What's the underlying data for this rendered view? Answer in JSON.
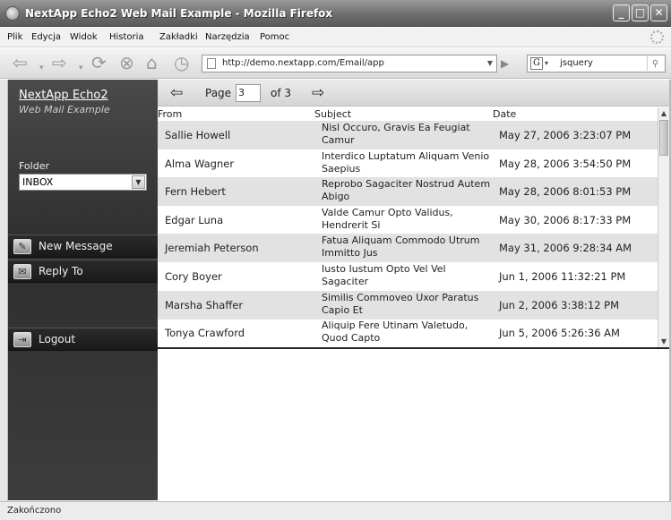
{
  "window": {
    "title": "NextApp Echo2 Web Mail Example - Mozilla Firefox"
  },
  "menu": [
    "Plik",
    "Edycja",
    "Widok",
    "Historia",
    "Zakładki",
    "Narzędzia",
    "Pomoc"
  ],
  "toolbar": {
    "url": "http://demo.nextapp.com/Email/app",
    "search_value": "jsquery",
    "search_engine_letter": "G"
  },
  "app": {
    "brand": "NextApp Echo2",
    "brand_subtitle": "Web Mail Example",
    "folder_label": "Folder",
    "folder_selected": "INBOX",
    "buttons": {
      "new_message": "New Message",
      "reply_to": "Reply To",
      "logout": "Logout"
    },
    "pager": {
      "page_label": "Page",
      "page_value": "3",
      "of_label": "of 3"
    },
    "columns": {
      "from": "From",
      "subject": "Subject",
      "date": "Date"
    },
    "messages": [
      {
        "from": "Sallie Howell",
        "subject": "Nisl Occuro, Gravis Ea Feugiat Camur",
        "date": "May 27, 2006 3:23:07 PM"
      },
      {
        "from": "Alma Wagner",
        "subject": "Interdico Luptatum Aliquam Venio Saepius",
        "date": "May 28, 2006 3:54:50 PM"
      },
      {
        "from": "Fern Hebert",
        "subject": "Reprobo Sagaciter Nostrud Autem Abigo",
        "date": "May 28, 2006 8:01:53 PM"
      },
      {
        "from": "Edgar Luna",
        "subject": "Valde Camur Opto Validus, Hendrerit Si",
        "date": "May 30, 2006 8:17:33 PM"
      },
      {
        "from": "Jeremiah Peterson",
        "subject": "Fatua Aliquam Commodo Utrum Immitto Jus",
        "date": "May 31, 2006 9:28:34 AM"
      },
      {
        "from": "Cory Boyer",
        "subject": "Iusto Iustum Opto Vel Vel Sagaciter",
        "date": "Jun 1, 2006 11:32:21 PM"
      },
      {
        "from": "Marsha Shaffer",
        "subject": "Similis Commoveo Uxor Paratus Capio Et",
        "date": "Jun 2, 2006 3:38:12 PM"
      },
      {
        "from": "Tonya Crawford",
        "subject": "Aliquip Fere Utinam Valetudo, Quod Capto",
        "date": "Jun 5, 2006 5:26:36 AM"
      }
    ]
  },
  "status": {
    "text": "Zakończono"
  }
}
